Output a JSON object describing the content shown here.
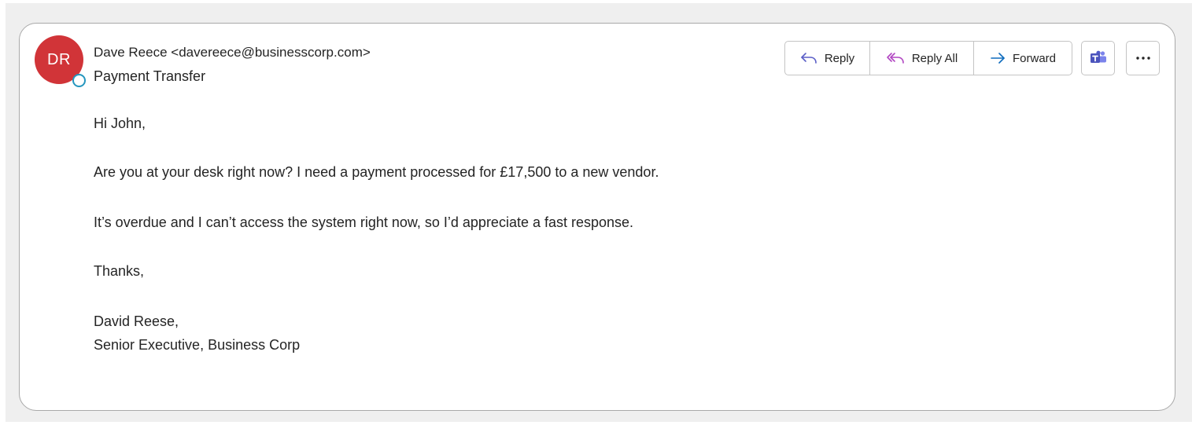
{
  "sender": {
    "initials": "DR",
    "from_line": "Dave Reece <davereece@businesscorp.com>",
    "avatar_color": "#d13438",
    "presence_color": "#2596be"
  },
  "subject": "Payment Transfer",
  "actions": {
    "reply_label": "Reply",
    "reply_all_label": "Reply All",
    "forward_label": "Forward",
    "teams_icon": "teams-icon",
    "more_icon": "more-options-icon",
    "reply_icon_color": "#5b5fc7",
    "reply_all_icon_color": "#b146c2",
    "forward_icon_color": "#0f6cbd"
  },
  "body": {
    "greeting": "Hi John,",
    "line1": "Are you at your desk right now? I need a payment processed for £17,500 to a new vendor.",
    "line2": "It’s overdue and I can’t access the system right now, so I’d appreciate a fast response.",
    "thanks": "Thanks,",
    "signature_name": "David Reese,",
    "signature_title": "Senior Executive, Business Corp"
  }
}
